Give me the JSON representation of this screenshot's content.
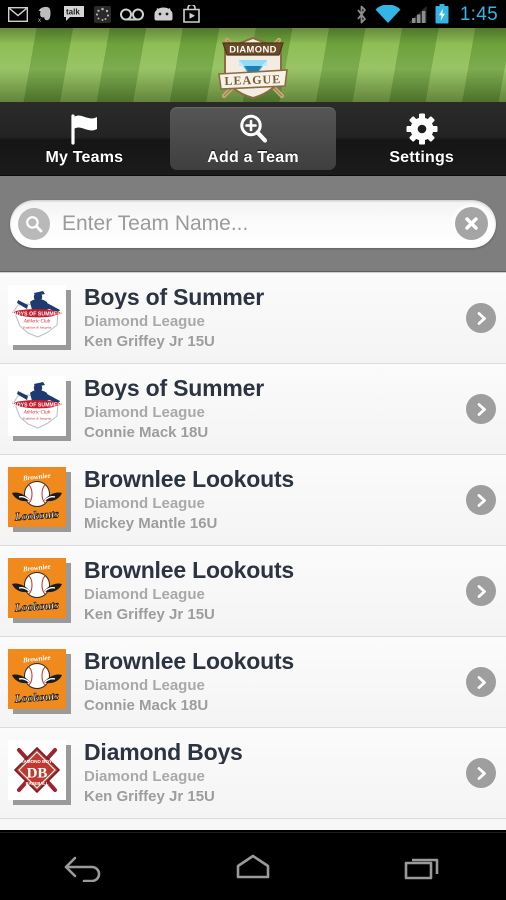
{
  "status_bar": {
    "time": "1:45",
    "left_icons": [
      "gmail-icon",
      "evernote-icon",
      "google-talk-icon",
      "sync-icon",
      "voicemail-icon",
      "android-icon",
      "play-store-icon"
    ],
    "right_icons": [
      "bluetooth-icon",
      "wifi-icon",
      "cell-signal-icon",
      "battery-charging-icon"
    ],
    "accent_color": "#33b5e5"
  },
  "banner": {
    "logo_top_text": "DIAMOND",
    "logo_bottom_text": "LEAGUE",
    "grass_light": "#8ebe55",
    "grass_dark": "#6ea23c"
  },
  "tabs": [
    {
      "label": "My Teams",
      "icon": "flag-icon",
      "selected": false
    },
    {
      "label": "Add a Team",
      "icon": "search-plus-icon",
      "selected": true
    },
    {
      "label": "Settings",
      "icon": "gear-icon",
      "selected": false
    }
  ],
  "search": {
    "placeholder": "Enter Team Name...",
    "value": "",
    "search_icon": "magnifier-icon",
    "clear_icon": "clear-x-icon"
  },
  "teams": [
    {
      "name": "Boys of Summer",
      "league": "Diamond League",
      "division": "Ken Griffey Jr 15U",
      "logo": "boys-of-summer-logo"
    },
    {
      "name": "Boys of Summer",
      "league": "Diamond League",
      "division": "Connie Mack 18U",
      "logo": "boys-of-summer-logo"
    },
    {
      "name": "Brownlee Lookouts",
      "league": "Diamond League",
      "division": "Mickey Mantle 16U",
      "logo": "brownlee-lookouts-logo"
    },
    {
      "name": "Brownlee Lookouts",
      "league": "Diamond League",
      "division": "Ken Griffey Jr 15U",
      "logo": "brownlee-lookouts-logo"
    },
    {
      "name": "Brownlee Lookouts",
      "league": "Diamond League",
      "division": "Connie Mack 18U",
      "logo": "brownlee-lookouts-logo"
    },
    {
      "name": "Diamond Boys",
      "league": "Diamond League",
      "division": "Ken Griffey Jr 15U",
      "logo": "diamond-boys-logo"
    }
  ],
  "row_chevron_icon": "chevron-right-icon",
  "nav_bar": {
    "back": "back-icon",
    "home": "home-icon",
    "recents": "recents-icon"
  }
}
